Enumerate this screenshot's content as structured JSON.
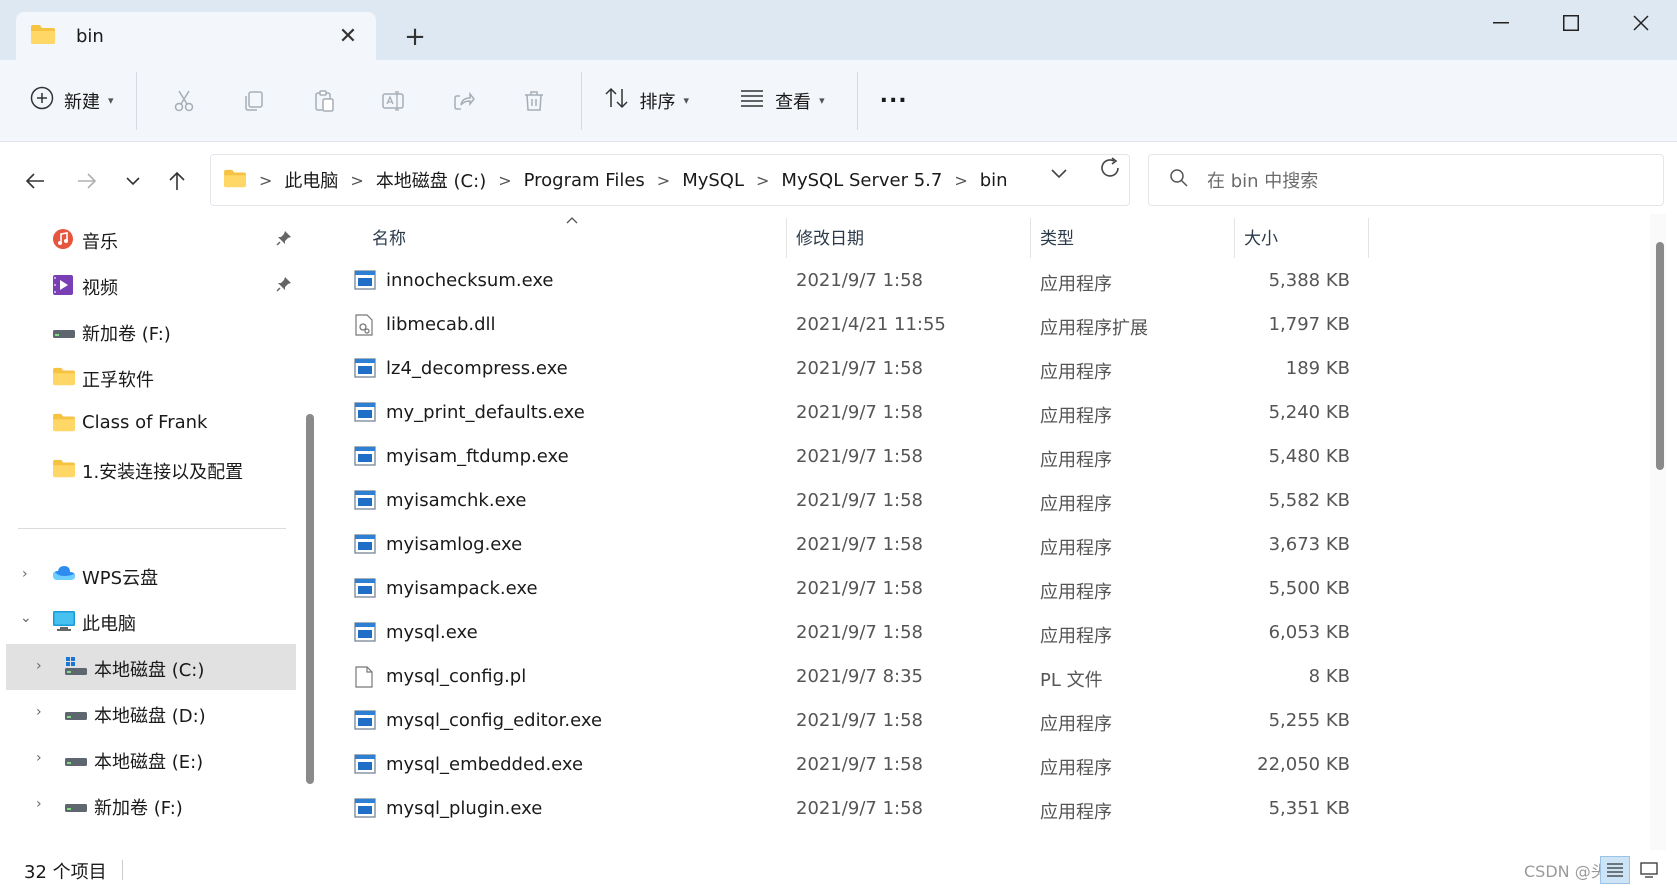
{
  "window": {
    "tab_title": "bin",
    "new_tab": "+",
    "close_tab": "✕"
  },
  "toolbar": {
    "new_label": "新建",
    "sort_label": "排序",
    "view_label": "查看",
    "more_label": "..."
  },
  "address": {
    "crumbs": [
      "此电脑",
      "本地磁盘 (C:)",
      "Program Files",
      "MySQL",
      "MySQL Server 5.7",
      "bin"
    ],
    "separator": ">"
  },
  "search": {
    "placeholder": "在 bin 中搜索"
  },
  "sidebar": {
    "items": [
      {
        "label": "音乐",
        "icon": "music-icon",
        "pinned": true
      },
      {
        "label": "视频",
        "icon": "video-icon",
        "pinned": true
      },
      {
        "label": "新加卷 (F:)",
        "icon": "drive-icon"
      },
      {
        "label": "正孚软件",
        "icon": "folder-icon"
      },
      {
        "label": "Class of Frank",
        "icon": "folder-icon"
      },
      {
        "label": "1.安装连接以及配置",
        "icon": "folder-icon"
      }
    ],
    "tree": [
      {
        "label": "WPS云盘",
        "icon": "cloud-icon"
      },
      {
        "label": "此电脑",
        "icon": "computer-icon"
      },
      {
        "label": "本地磁盘 (C:)",
        "icon": "windows-drive-icon"
      },
      {
        "label": "本地磁盘 (D:)",
        "icon": "drive-icon"
      },
      {
        "label": "本地磁盘 (E:)",
        "icon": "drive-icon"
      },
      {
        "label": "新加卷 (F:)",
        "icon": "drive-icon"
      }
    ]
  },
  "columns": {
    "name": "名称",
    "date": "修改日期",
    "type": "类型",
    "size": "大小"
  },
  "files": [
    {
      "name": "innochecksum.exe",
      "date": "2021/9/7 1:58",
      "type": "应用程序",
      "size": "5,388 KB",
      "icon": "exe-icon"
    },
    {
      "name": "libmecab.dll",
      "date": "2021/4/21 11:55",
      "type": "应用程序扩展",
      "size": "1,797 KB",
      "icon": "dll-icon"
    },
    {
      "name": "lz4_decompress.exe",
      "date": "2021/9/7 1:58",
      "type": "应用程序",
      "size": "189 KB",
      "icon": "exe-icon"
    },
    {
      "name": "my_print_defaults.exe",
      "date": "2021/9/7 1:58",
      "type": "应用程序",
      "size": "5,240 KB",
      "icon": "exe-icon"
    },
    {
      "name": "myisam_ftdump.exe",
      "date": "2021/9/7 1:58",
      "type": "应用程序",
      "size": "5,480 KB",
      "icon": "exe-icon"
    },
    {
      "name": "myisamchk.exe",
      "date": "2021/9/7 1:58",
      "type": "应用程序",
      "size": "5,582 KB",
      "icon": "exe-icon"
    },
    {
      "name": "myisamlog.exe",
      "date": "2021/9/7 1:58",
      "type": "应用程序",
      "size": "3,673 KB",
      "icon": "exe-icon"
    },
    {
      "name": "myisampack.exe",
      "date": "2021/9/7 1:58",
      "type": "应用程序",
      "size": "5,500 KB",
      "icon": "exe-icon"
    },
    {
      "name": "mysql.exe",
      "date": "2021/9/7 1:58",
      "type": "应用程序",
      "size": "6,053 KB",
      "icon": "exe-icon"
    },
    {
      "name": "mysql_config.pl",
      "date": "2021/9/7 8:35",
      "type": "PL 文件",
      "size": "8 KB",
      "icon": "file-icon"
    },
    {
      "name": "mysql_config_editor.exe",
      "date": "2021/9/7 1:58",
      "type": "应用程序",
      "size": "5,255 KB",
      "icon": "exe-icon"
    },
    {
      "name": "mysql_embedded.exe",
      "date": "2021/9/7 1:58",
      "type": "应用程序",
      "size": "22,050 KB",
      "icon": "exe-icon"
    },
    {
      "name": "mysql_plugin.exe",
      "date": "2021/9/7 1:58",
      "type": "应用程序",
      "size": "5,351 KB",
      "icon": "exe-icon"
    }
  ],
  "status": {
    "count": "32 个项目",
    "watermark": "CSDN @头要"
  },
  "colors": {
    "titlebar": "#dde8f3",
    "toolbar": "#f3f6fa",
    "selected": "#e1e1e1",
    "accent": "#0067c0"
  }
}
